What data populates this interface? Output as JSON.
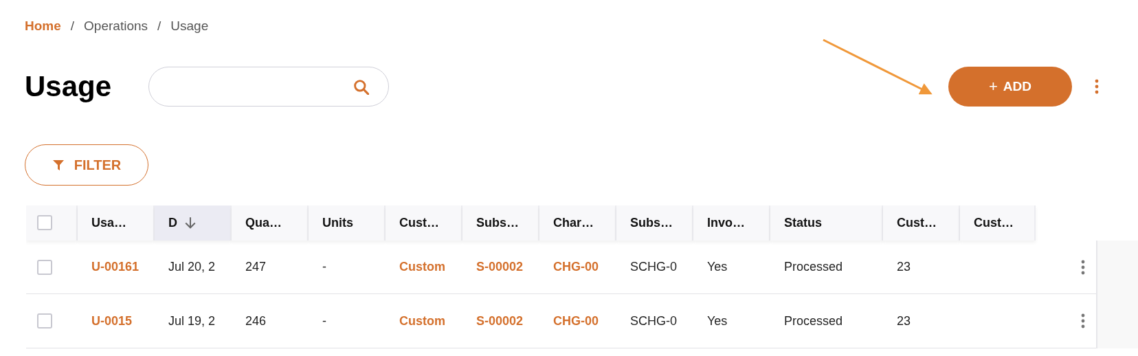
{
  "breadcrumb": [
    {
      "label": "Home",
      "kind": "link"
    },
    {
      "label": "Operations",
      "kind": "text"
    },
    {
      "label": "Usage",
      "kind": "text"
    }
  ],
  "breadcrumb_separator": "/",
  "title": "Usage",
  "add_button": {
    "icon": "+",
    "label": "ADD"
  },
  "filter_button": {
    "label": "FILTER"
  },
  "table": {
    "select_all": {
      "checked": false
    },
    "columns": [
      {
        "label": "Usa…",
        "selected": false
      },
      {
        "label": "D",
        "selected": true
      },
      {
        "label": "Qua…",
        "selected": false
      },
      {
        "label": "Units",
        "selected": false
      },
      {
        "label": "Cust…",
        "selected": false
      },
      {
        "label": "Subs…",
        "selected": false
      },
      {
        "label": "Char…",
        "selected": false
      },
      {
        "label": "Subs…",
        "selected": false
      },
      {
        "label": "Invo…",
        "selected": false
      },
      {
        "label": "Status",
        "selected": false
      },
      {
        "label": "Cust…",
        "selected": false
      },
      {
        "label": "Cust…",
        "selected": false
      }
    ],
    "rows": [
      {
        "checked": false,
        "cells": [
          {
            "kind": "link",
            "text": "U-00161"
          },
          {
            "kind": "text",
            "text": "Jul 20, 2"
          },
          {
            "kind": "text",
            "text": "247"
          },
          {
            "kind": "text",
            "text": "-"
          },
          {
            "kind": "link",
            "text": "Custom"
          },
          {
            "kind": "link",
            "text": "S-00002"
          },
          {
            "kind": "link",
            "text": "CHG-00"
          },
          {
            "kind": "text",
            "text": "SCHG-0"
          },
          {
            "kind": "text",
            "text": "Yes"
          },
          {
            "kind": "text",
            "text": "Processed"
          },
          {
            "kind": "text",
            "text": "23"
          }
        ]
      },
      {
        "checked": false,
        "cells": [
          {
            "kind": "link",
            "text": "U-0015"
          },
          {
            "kind": "text",
            "text": "Jul 19, 2"
          },
          {
            "kind": "text",
            "text": "246"
          },
          {
            "kind": "text",
            "text": "-"
          },
          {
            "kind": "link",
            "text": "Custom"
          },
          {
            "kind": "link",
            "text": "S-00002"
          },
          {
            "kind": "link",
            "text": "CHG-00"
          },
          {
            "kind": "text",
            "text": "SCHG-0"
          },
          {
            "kind": "text",
            "text": "Yes"
          },
          {
            "kind": "text",
            "text": "Processed"
          },
          {
            "kind": "text",
            "text": "23"
          }
        ]
      }
    ]
  }
}
